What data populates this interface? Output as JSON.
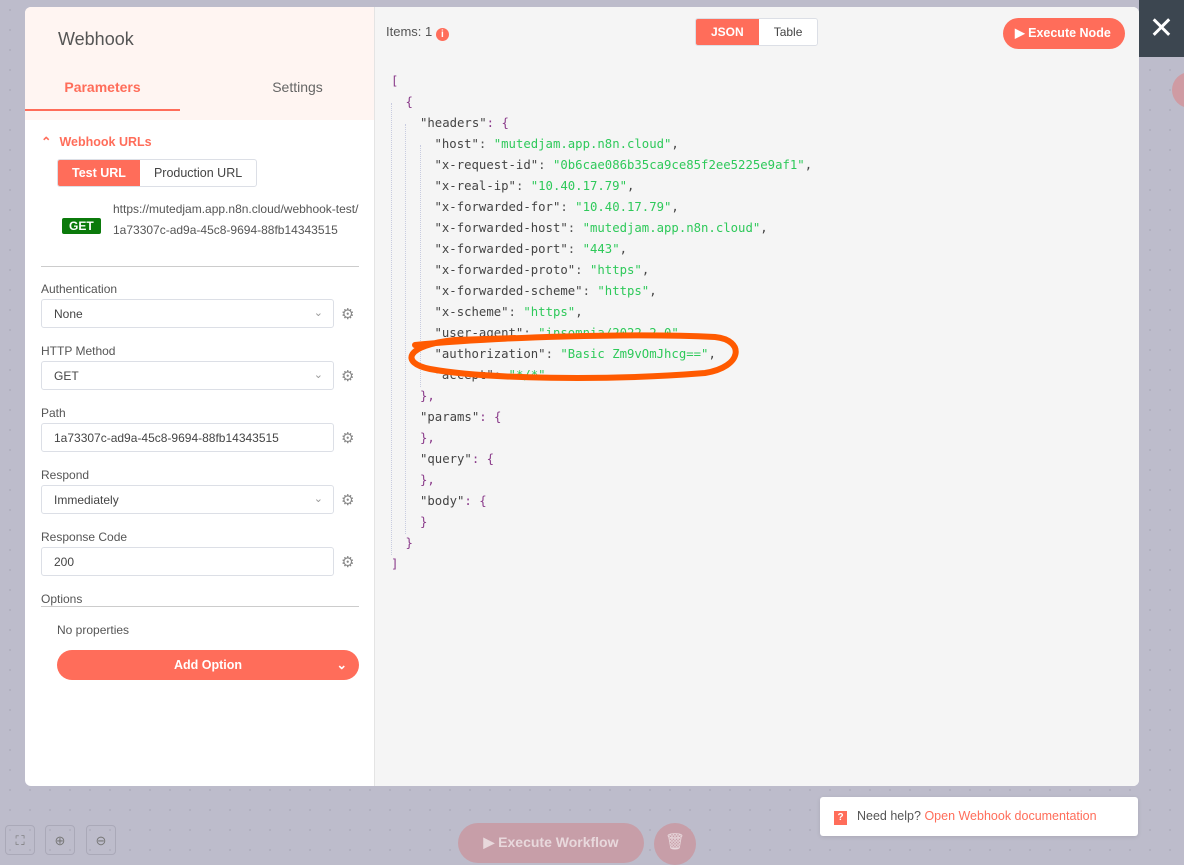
{
  "node": {
    "title": "Webhook",
    "tabs": [
      "Parameters",
      "Settings"
    ]
  },
  "webhook_urls": {
    "header": "Webhook URLs",
    "buttons": [
      "Test URL",
      "Production URL"
    ],
    "method": "GET",
    "url": "https://mutedjam.app.n8n.cloud/webhook-test/1a73307c-ad9a-45c8-9694-88fb14343515"
  },
  "fields": [
    {
      "label": "Authentication",
      "value": "None",
      "type": "select"
    },
    {
      "label": "HTTP Method",
      "value": "GET",
      "type": "select"
    },
    {
      "label": "Path",
      "value": "1a73307c-ad9a-45c8-9694-88fb14343515",
      "type": "text"
    },
    {
      "label": "Respond",
      "value": "Immediately",
      "type": "select"
    },
    {
      "label": "Response Code",
      "value": "200",
      "type": "text"
    }
  ],
  "options": {
    "label": "Options",
    "empty": "No properties",
    "add_button": "Add Option"
  },
  "output": {
    "items_label": "Items: 1",
    "info_icon": "i",
    "views": [
      "JSON",
      "Table"
    ],
    "execute_button": "Execute Node",
    "json_lines": [
      {
        "i": 0,
        "p": "["
      },
      {
        "i": 1,
        "p": "{"
      },
      {
        "i": 2,
        "k": "\"headers\"",
        "p": ": {"
      },
      {
        "i": 3,
        "k": "\"host\"",
        "v": "\"mutedjam.app.n8n.cloud\"",
        "e": ","
      },
      {
        "i": 3,
        "k": "\"x-request-id\"",
        "v": "\"0b6cae086b35ca9ce85f2ee5225e9af1\"",
        "e": ","
      },
      {
        "i": 3,
        "k": "\"x-real-ip\"",
        "v": "\"10.40.17.79\"",
        "e": ","
      },
      {
        "i": 3,
        "k": "\"x-forwarded-for\"",
        "v": "\"10.40.17.79\"",
        "e": ","
      },
      {
        "i": 3,
        "k": "\"x-forwarded-host\"",
        "v": "\"mutedjam.app.n8n.cloud\"",
        "e": ","
      },
      {
        "i": 3,
        "k": "\"x-forwarded-port\"",
        "v": "\"443\"",
        "e": ","
      },
      {
        "i": 3,
        "k": "\"x-forwarded-proto\"",
        "v": "\"https\"",
        "e": ","
      },
      {
        "i": 3,
        "k": "\"x-forwarded-scheme\"",
        "v": "\"https\"",
        "e": ","
      },
      {
        "i": 3,
        "k": "\"x-scheme\"",
        "v": "\"https\"",
        "e": ","
      },
      {
        "i": 3,
        "k": "\"user-agent\"",
        "v": "\"insomnia/2022.2.0\"",
        "e": ","
      },
      {
        "i": 3,
        "k": "\"authorization\"",
        "v": "\"Basic Zm9vOmJhcg==\"",
        "e": ","
      },
      {
        "i": 3,
        "k": "\"accept\"",
        "v": "\"*/*\"",
        "e": ""
      },
      {
        "i": 2,
        "p": "},"
      },
      {
        "i": 2,
        "k": "\"params\"",
        "p": ": {"
      },
      {
        "i": 2,
        "p": "},"
      },
      {
        "i": 2,
        "k": "\"query\"",
        "p": ": {"
      },
      {
        "i": 2,
        "p": "},"
      },
      {
        "i": 2,
        "k": "\"body\"",
        "p": ": {"
      },
      {
        "i": 2,
        "p": "}"
      },
      {
        "i": 1,
        "p": "}"
      },
      {
        "i": 0,
        "p": "]"
      }
    ]
  },
  "help": {
    "prefix": "Need help?",
    "link": "Open Webhook documentation"
  },
  "canvas": {
    "execute_workflow": "Execute Workflow"
  },
  "colors": {
    "accent": "#ff6d5a",
    "annotation": "#ff5a00",
    "get": "#0b7a0b"
  }
}
